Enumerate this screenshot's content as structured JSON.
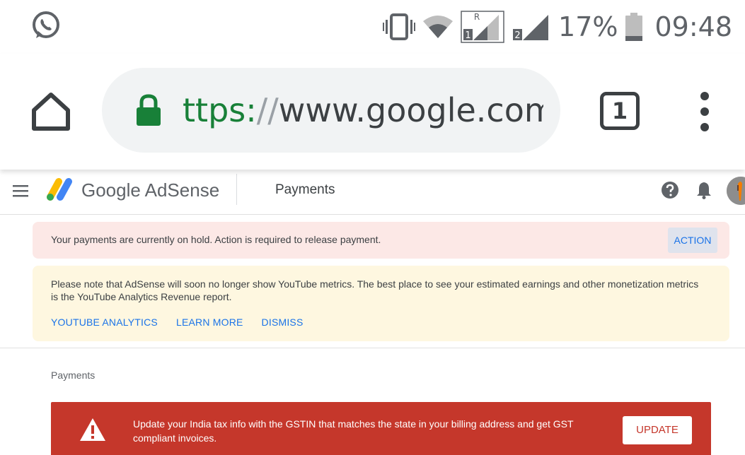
{
  "status_bar": {
    "battery_percent": "17%",
    "time": "09:48",
    "sim1_label": "1",
    "sim1_roaming": "R",
    "sim2_label": "2",
    "icons": [
      "whatsapp-icon",
      "vibrate-icon",
      "wifi-icon",
      "signal-sim1-icon",
      "signal-sim2-icon",
      "battery-icon"
    ]
  },
  "browser": {
    "url_scheme": "ttps:",
    "url_separator": "//",
    "url_host": "www.google.com",
    "tab_count": "1",
    "colors": {
      "secure": "#188038",
      "pill": "#f1f3f4"
    }
  },
  "app_header": {
    "logo_text": "Google AdSense",
    "page_title": "Payments"
  },
  "alerts": {
    "hold": {
      "message": "Your payments are currently on hold. Action is required to release payment.",
      "action_label": "ACTION"
    },
    "youtube": {
      "message": "Please note that AdSense will soon no longer show YouTube metrics. The best place to see your estimated earnings and other monetization metrics is the YouTube Analytics Revenue report.",
      "links": [
        "YOUTUBE ANALYTICS",
        "LEARN MORE",
        "DISMISS"
      ]
    }
  },
  "main": {
    "section_label": "Payments",
    "gst_banner": {
      "message": "Update your India tax info with the GSTIN that matches the state in your billing address and get GST compliant invoices.",
      "button_label": "UPDATE",
      "color": "#c5372b"
    }
  }
}
